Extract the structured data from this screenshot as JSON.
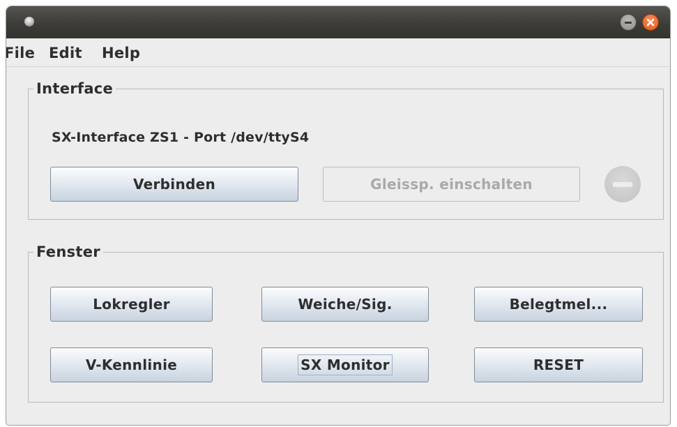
{
  "menubar": {
    "items": [
      {
        "label": "File"
      },
      {
        "label": "Edit"
      },
      {
        "label": "Help"
      }
    ]
  },
  "interface_group": {
    "title": "Interface",
    "info": "SX-Interface ZS1 - Port /dev/ttyS4",
    "connect_label": "Verbinden",
    "power_label": "Gleissp. einschalten",
    "power_enabled": false,
    "status_icon": "disabled-indicator-icon"
  },
  "fenster_group": {
    "title": "Fenster",
    "buttons": [
      {
        "label": "Lokregler"
      },
      {
        "label": "Weiche/Sig."
      },
      {
        "label": "Belegtmel..."
      },
      {
        "label": "V-Kennlinie"
      },
      {
        "label": "SX Monitor"
      },
      {
        "label": "RESET"
      }
    ]
  },
  "colors": {
    "titlebar": "#3b3a36",
    "close_button": "#e25a1c",
    "window_background": "#ededed"
  }
}
